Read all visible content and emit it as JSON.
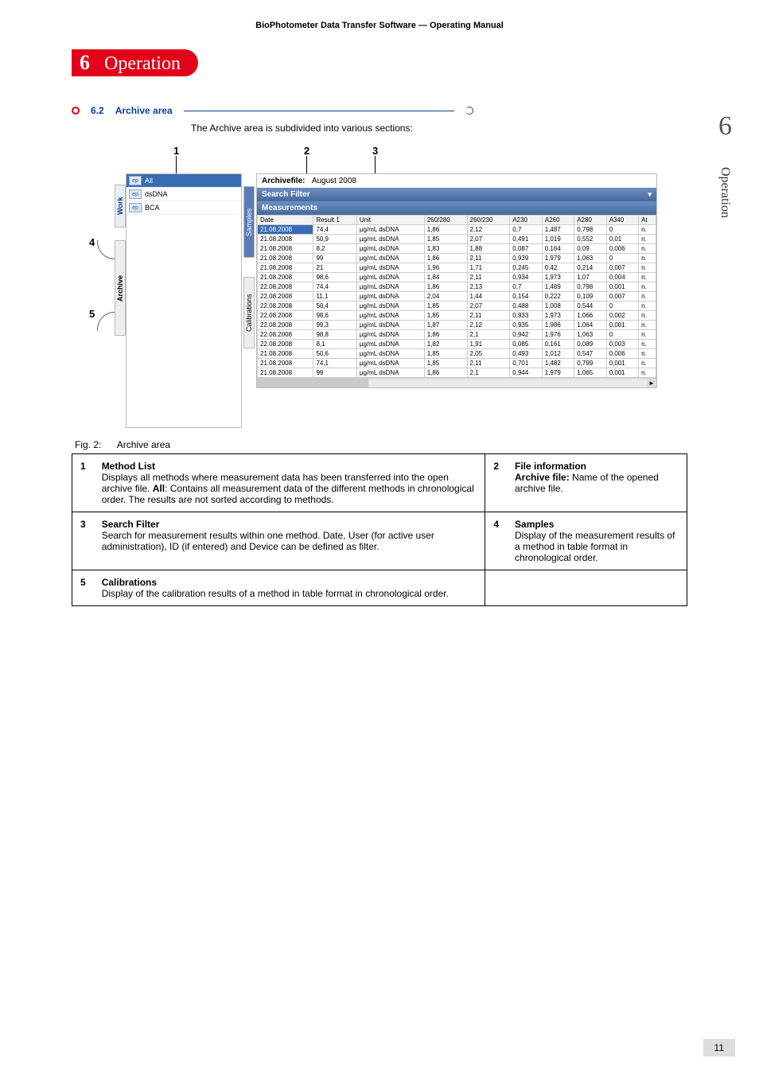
{
  "header": "BioPhotometer Data Transfer Software  —  Operating Manual",
  "big_section_num": "6",
  "side_label": "Operation",
  "page_number": "11",
  "chapter": {
    "num": "6",
    "title": "Operation"
  },
  "section": {
    "num": "6.2",
    "title": "Archive area"
  },
  "intro": "The Archive area is subdivided into various sections:",
  "callouts": {
    "c1": "1",
    "c2": "2",
    "c3": "3",
    "c4": "4",
    "c5": "5"
  },
  "vtabs": {
    "work": "Work",
    "archive": "Archive",
    "samples": "Samples",
    "calibrations": "Calibrations"
  },
  "methods": {
    "ep": "ep",
    "all": "All",
    "dsdna": "dsDNA",
    "bca": "BCA"
  },
  "archivefile_label": "Archivefile:",
  "archivefile_value": "August 2008",
  "search_filter_label": "Search Filter",
  "measurements_label": "Measurements",
  "columns": [
    "Date",
    "Result 1",
    "Unit",
    "260/280",
    "260/230",
    "A230",
    "A260",
    "A280",
    "A340",
    "At"
  ],
  "rows": [
    [
      "21.08.2008",
      "74,4",
      "µg/mL dsDNA",
      "1,86",
      "2,12",
      "0,7",
      "1,487",
      "0,798",
      "0",
      "n."
    ],
    [
      "21.08.2008",
      "50,9",
      "µg/mL dsDNA",
      "1,85",
      "2,07",
      "0,491",
      "1,019",
      "0,552",
      "0,01",
      "n."
    ],
    [
      "21.08.2008",
      "8,2",
      "µg/mL dsDNA",
      "1,83",
      "1,88",
      "0,087",
      "0,164",
      "0,09",
      "0,006",
      "n."
    ],
    [
      "21.08.2008",
      "99",
      "µg/mL dsDNA",
      "1,86",
      "2,11",
      "0,939",
      "1,979",
      "1,063",
      "0",
      "n."
    ],
    [
      "21.08.2008",
      "21",
      "µg/mL dsDNA",
      "1,96",
      "1,71",
      "0,245",
      "0,42",
      "0,214",
      "0,007",
      "n."
    ],
    [
      "21.08.2008",
      "98,6",
      "µg/mL dsDNA",
      "1,84",
      "2,11",
      "0,934",
      "1,973",
      "1,07",
      "0,004",
      "n."
    ],
    [
      "22.08.2008",
      "74,4",
      "µg/mL dsDNA",
      "1,86",
      "2,13",
      "0,7",
      "1,489",
      "0,798",
      "0,001",
      "n."
    ],
    [
      "22.08.2008",
      "11,1",
      "µg/mL dsDNA",
      "2,04",
      "1,44",
      "0,154",
      "0,222",
      "0,109",
      "0,007",
      "n."
    ],
    [
      "22.08.2008",
      "50,4",
      "µg/mL dsDNA",
      "1,85",
      "2,07",
      "0,488",
      "1,008",
      "0,544",
      "0",
      "n."
    ],
    [
      "22.08.2008",
      "98,6",
      "µg/mL dsDNA",
      "1,85",
      "2,11",
      "0,933",
      "1,973",
      "1,066",
      "0,002",
      "n."
    ],
    [
      "22.08.2008",
      "99,3",
      "µg/mL dsDNA",
      "1,87",
      "2,12",
      "0,935",
      "1,986",
      "1,064",
      "0,001",
      "n."
    ],
    [
      "22.08.2008",
      "98,8",
      "µg/mL dsDNA",
      "1,86",
      "2,1",
      "0,942",
      "1,976",
      "1,063",
      "0",
      "n."
    ],
    [
      "22.08.2008",
      "8,1",
      "µg/mL dsDNA",
      "1,82",
      "1,91",
      "0,085",
      "0,161",
      "0,089",
      "0,003",
      "n."
    ],
    [
      "21.08.2008",
      "50,6",
      "µg/mL dsDNA",
      "1,85",
      "2,05",
      "0,493",
      "1,012",
      "0,547",
      "0,006",
      "n."
    ],
    [
      "21.08.2008",
      "74,1",
      "µg/mL dsDNA",
      "1,85",
      "2,11",
      "0,701",
      "1,482",
      "0,799",
      "0,001",
      "n."
    ],
    [
      "21.08.2008",
      "99",
      "µg/mL dsDNA",
      "1,86",
      "2,1",
      "0,944",
      "1,979",
      "1,065",
      "0,001",
      "n."
    ]
  ],
  "fig_caption_label": "Fig. 2:",
  "fig_caption_text": "Archive area",
  "legend": [
    {
      "n": "1",
      "title": "Method List",
      "body": "Displays all methods where measurement data has been transferred into the open archive file. ",
      "bold": "All",
      "body2": ": Contains all measurement data of the different methods in chronological order. The results are not sorted according to methods."
    },
    {
      "n": "2",
      "title": "File information",
      "body": "",
      "bold": "Archive file:",
      "body2": " Name of the opened archive file."
    },
    {
      "n": "3",
      "title": "Search Filter",
      "body": "Search for measurement results within one method. Date, User (for active user administration), ID (if entered) and Device can be defined as filter.",
      "bold": "",
      "body2": ""
    },
    {
      "n": "4",
      "title": "Samples",
      "body": "Display of the measurement results of a method in table format in chronological order.",
      "bold": "",
      "body2": ""
    },
    {
      "n": "5",
      "title": "Calibrations",
      "body": "Display of the calibration results of a method in table format in chronological order.",
      "bold": "",
      "body2": ""
    }
  ]
}
